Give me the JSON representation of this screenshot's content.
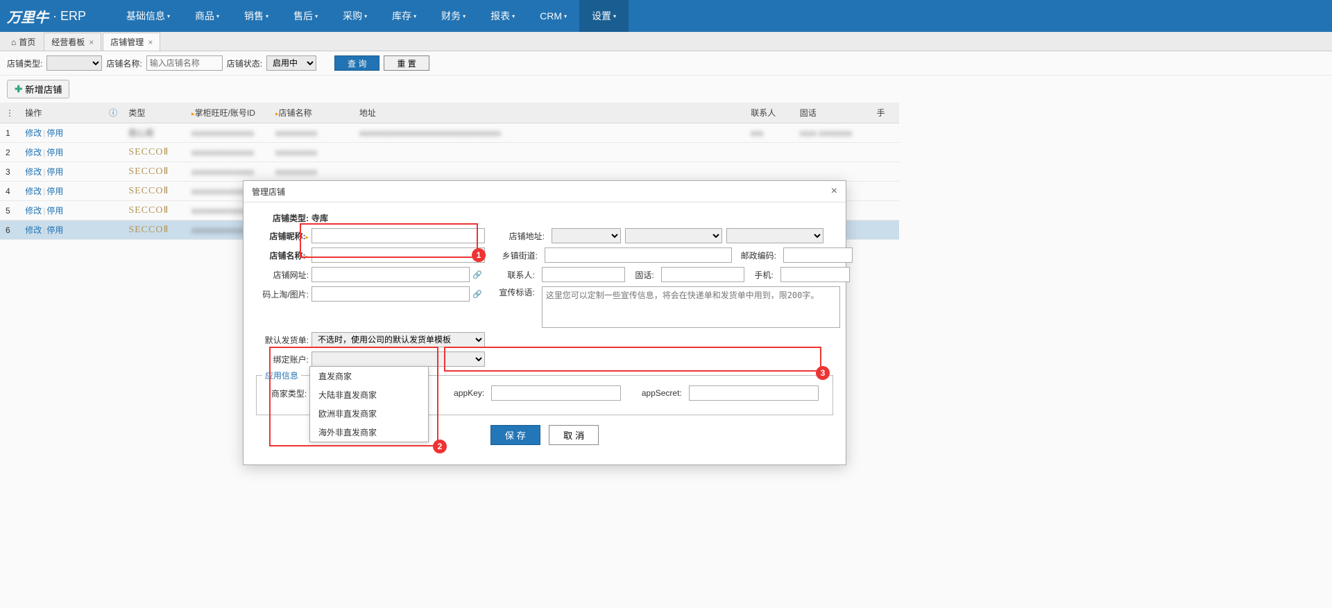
{
  "brand": {
    "logo": "万里牛",
    "erp": "· ERP"
  },
  "nav": [
    "基础信息",
    "商品",
    "销售",
    "售后",
    "采购",
    "库存",
    "财务",
    "报表",
    "CRM",
    "设置"
  ],
  "nav_active_index": 9,
  "home_tab": "首页",
  "tabs": [
    {
      "label": "经营看板",
      "active": false
    },
    {
      "label": "店铺管理",
      "active": true
    }
  ],
  "filter": {
    "type_label": "店铺类型:",
    "name_label": "店铺名称:",
    "name_placeholder": "输入店铺名称",
    "status_label": "店铺状态:",
    "status_value": "启用中",
    "query_btn": "查 询",
    "reset_btn": "重 置"
  },
  "add_btn": "新增店铺",
  "columns": {
    "op": "操作",
    "type": "类型",
    "wangwang": "掌柜旺旺/账号ID",
    "shopname": "店铺名称",
    "addr": "地址",
    "contact": "联系人",
    "tel": "固话",
    "mobile": "手"
  },
  "row_actions": {
    "edit": "修改",
    "disable": "停用"
  },
  "row_brand": "SECCOⅡ",
  "rows": [
    1,
    2,
    3,
    4,
    5,
    6
  ],
  "modal": {
    "title": "管理店铺",
    "labels": {
      "type": "店铺类型:",
      "type_val": "寺库",
      "nick": "店铺昵称:",
      "name": "店铺名称:",
      "url": "店铺网址:",
      "mst": "码上淘/图片:",
      "default_ship": "默认发货单:",
      "bind_acc": "绑定账户:",
      "addr": "店铺地址:",
      "town": "乡镇街道:",
      "zip": "邮政编码:",
      "contact": "联系人:",
      "tel": "固话:",
      "mobile": "手机:",
      "slogan": "宣传标语:"
    },
    "placeholders": {
      "default_ship": "不选时，使用公司的默认发货单模板",
      "slogan": "这里您可以定制一些宣传信息，将会在快递单和发货单中用到，限200字。"
    },
    "fieldset": {
      "legend": "应用信息",
      "merchant_type": "商家类型:",
      "appkey": "appKey:",
      "appsecret": "appSecret:"
    },
    "dropdown": [
      "直发商家",
      "大陆非直发商家",
      "欧洲非直发商家",
      "海外非直发商家"
    ],
    "save": "保 存",
    "cancel": "取 消"
  }
}
